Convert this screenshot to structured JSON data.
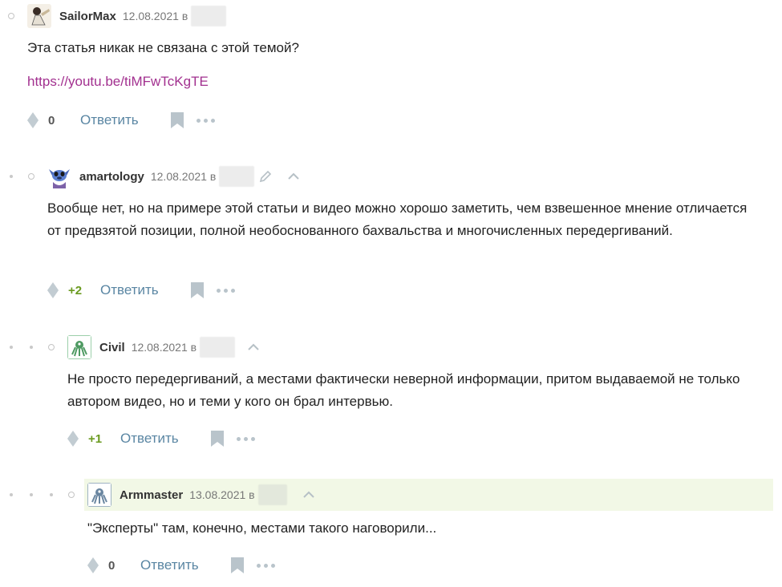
{
  "comments": [
    {
      "username": "SailorMax",
      "date": "12.08.2021 в",
      "text": "Эта статья никак не связана с этой темой?",
      "link": "https://youtu.be/tiMFwTcKgTE",
      "score": "0",
      "reply_label": "Ответить"
    },
    {
      "username": "amartology",
      "date": "12.08.2021 в",
      "text": "Вообще нет, но на примере этой статьи и видео можно хорошо заметить, чем взвешенное мнение отличается от предвзятой позиции, полной необоснованного бахвальства и многочисленных передергиваний.",
      "score": "+2",
      "reply_label": "Ответить"
    },
    {
      "username": "Civil",
      "date": "12.08.2021 в",
      "text": "Не просто передергиваний, а местами фактически неверной информации, притом выдаваемой не только автором видео, но и теми у кого он брал интервью.",
      "score": "+1",
      "reply_label": "Ответить"
    },
    {
      "username": "Armmaster",
      "date": "13.08.2021 в",
      "text": "\"Эксперты\" там, конечно, местами такого наговорили...",
      "score": "0",
      "reply_label": "Ответить"
    }
  ],
  "colors": {
    "link": "#a2308f",
    "reply": "#5a86a3",
    "positive_score": "#6a9a1f",
    "highlight_bg": "#f2f8e6"
  },
  "icons": [
    "vote-icon",
    "bookmark-icon",
    "more-icon",
    "edit-icon",
    "chevron-up-icon"
  ]
}
